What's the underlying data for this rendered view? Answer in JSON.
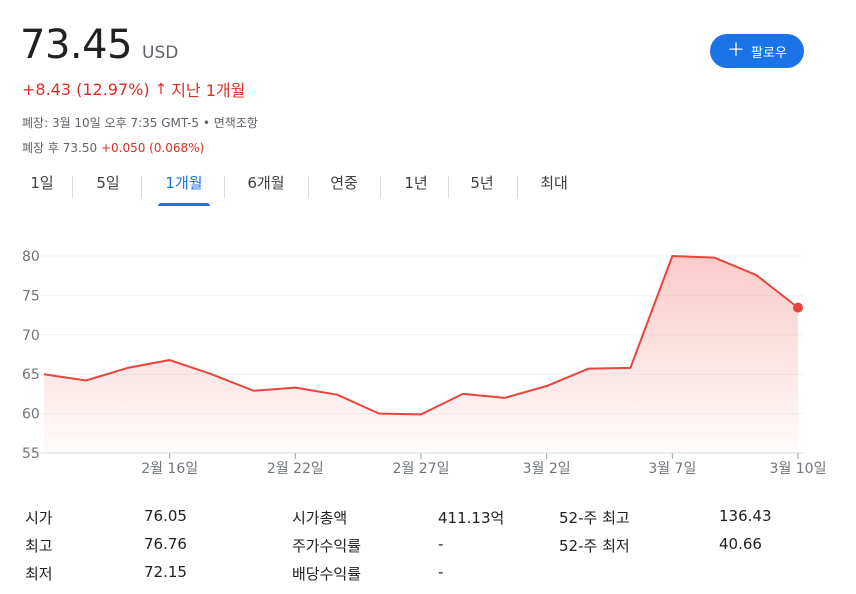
{
  "header": {
    "top_text": "· ·  · ·  ·   ·   · ·",
    "price": "73.45",
    "currency": "USD",
    "change": "+8.43 (12.97%)",
    "change_arrow": "↑",
    "period_label": "지난 1개월",
    "close_info": "폐장: 3월 10일 오후 7:35 GMT-5 • 면책조항",
    "after_hours_label": "폐장 후 73.50",
    "after_hours_change": "+0.050 (0.068%)",
    "follow_icon": "＋",
    "follow_label": "팔로우"
  },
  "tabs": [
    {
      "label": "1일",
      "active": false
    },
    {
      "label": "5일",
      "active": false
    },
    {
      "label": "1개월",
      "active": true
    },
    {
      "label": "6개월",
      "active": false
    },
    {
      "label": "연중",
      "active": false
    },
    {
      "label": "1년",
      "active": false
    },
    {
      "label": "5년",
      "active": false
    },
    {
      "label": "최대",
      "active": false
    }
  ],
  "chart_data": {
    "type": "area",
    "title": "",
    "xlabel": "",
    "ylabel": "",
    "ylim": [
      55,
      80
    ],
    "yticks": [
      55,
      60,
      65,
      70,
      75,
      80
    ],
    "grid": true,
    "x_tick_labels": [
      "2월 16일",
      "2월 22일",
      "2월 27일",
      "3월 2일",
      "3월 7일",
      "3월 10일"
    ],
    "x_tick_dates": [
      "2023-02-16",
      "2023-02-22",
      "2023-02-27",
      "2023-03-02",
      "2023-03-07",
      "2023-03-10"
    ],
    "x": [
      "2023-02-10",
      "2023-02-13",
      "2023-02-14",
      "2023-02-15",
      "2023-02-16",
      "2023-02-17",
      "2023-02-21",
      "2023-02-22",
      "2023-02-23",
      "2023-02-24",
      "2023-02-27",
      "2023-02-28",
      "2023-03-01",
      "2023-03-02",
      "2023-03-03",
      "2023-03-06",
      "2023-03-07",
      "2023-03-08",
      "2023-03-09",
      "2023-03-10"
    ],
    "series": [
      {
        "values": [
          65.0,
          64.2,
          65.8,
          66.8,
          65.0,
          62.9,
          63.3,
          62.4,
          60.0,
          59.9,
          62.5,
          62.0,
          63.5,
          65.7,
          65.8,
          80.0,
          79.8,
          77.6,
          73.45
        ],
        "color": "#e8453c"
      }
    ],
    "note_first_point_date": "2023-02-13"
  }
}
